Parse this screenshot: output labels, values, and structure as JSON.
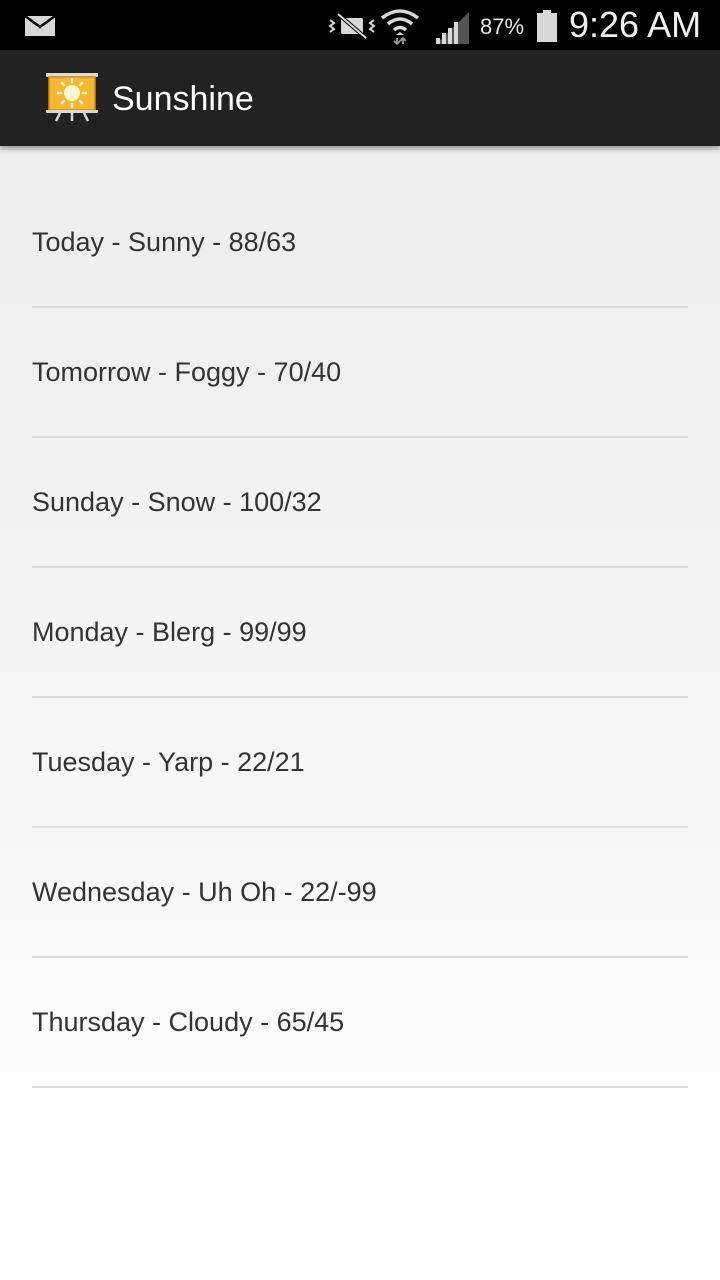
{
  "status_bar": {
    "battery_percent": "87%",
    "time": "9:26 AM",
    "icons": [
      "mail-icon",
      "mute-icon",
      "wifi-icon",
      "signal-icon",
      "battery-icon"
    ]
  },
  "action_bar": {
    "title": "Sunshine",
    "icon": "app-icon"
  },
  "forecast": [
    "Today - Sunny - 88/63",
    "Tomorrow - Foggy - 70/40",
    "Sunday - Snow - 100/32",
    "Monday - Blerg - 99/99",
    "Tuesday - Yarp - 22/21",
    "Wednesday - Uh Oh - 22/-99",
    "Thursday - Cloudy - 65/45"
  ],
  "colors": {
    "status_bar": "#000000",
    "action_bar": "#222222",
    "list_text": "#333333",
    "divider": "#dcdcdc",
    "app_icon_accent": "#f5b731"
  }
}
